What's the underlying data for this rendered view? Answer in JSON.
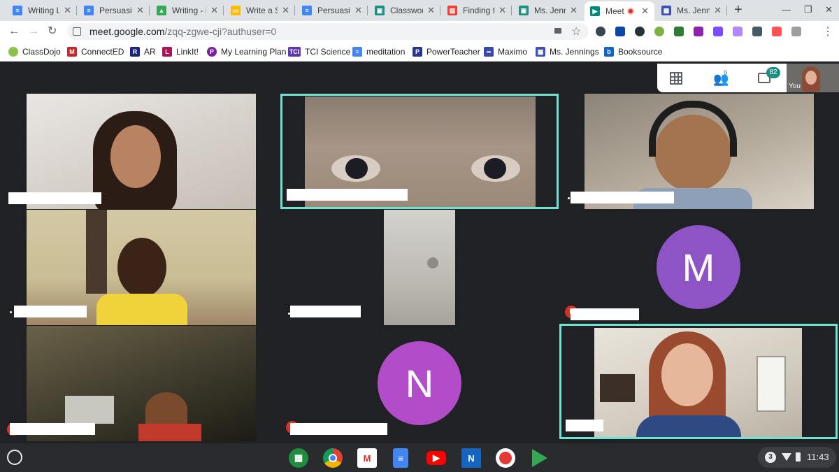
{
  "browser": {
    "tabs": [
      {
        "title": "Writing Le",
        "icon": "docs-icon",
        "color": "#4285f4",
        "active": false
      },
      {
        "title": "Persuasio",
        "icon": "docs-icon",
        "color": "#4285f4",
        "active": false
      },
      {
        "title": "Writing - F",
        "icon": "drive-icon",
        "color": "#34a853",
        "active": false
      },
      {
        "title": "Write a St",
        "icon": "slides-icon",
        "color": "#fbbc04",
        "active": false
      },
      {
        "title": "Persuasio",
        "icon": "docs-icon",
        "color": "#4285f4",
        "active": false
      },
      {
        "title": "Classwor",
        "icon": "classroom-icon",
        "color": "#1e8e7e",
        "active": false
      },
      {
        "title": "Finding fi",
        "icon": "calendar-icon",
        "color": "#ea4335",
        "active": false
      },
      {
        "title": "Ms. Jenni",
        "icon": "classroom-icon",
        "color": "#1e8e7e",
        "active": false
      },
      {
        "title": "Meet",
        "icon": "meet-icon",
        "color": "#00897b",
        "active": true
      },
      {
        "title": "Ms. Jenni",
        "icon": "forms-icon",
        "color": "#3f51b5",
        "active": false
      }
    ],
    "url_host": "meet.google.com",
    "url_path": "/zqq-zgwe-cji?authuser=0",
    "bookmarks": [
      {
        "label": "ClassDojo",
        "icon": "classdojo-icon",
        "color": "#8bc34a"
      },
      {
        "label": "ConnectED",
        "icon": "connected-icon",
        "color": "#c62828"
      },
      {
        "label": "AR",
        "icon": "ar-icon",
        "color": "#1a237e"
      },
      {
        "label": "LinkIt!",
        "icon": "linkit-icon",
        "color": "#ad1457"
      },
      {
        "label": "My Learning Plan",
        "icon": "mlp-icon",
        "color": "#7b1fa2"
      },
      {
        "label": "TCI Science",
        "icon": "tci-icon",
        "color": "#5e35b1"
      },
      {
        "label": "meditation",
        "icon": "docs-icon",
        "color": "#4285f4"
      },
      {
        "label": "PowerTeacher",
        "icon": "powerteacher-icon",
        "color": "#283593"
      },
      {
        "label": "Maximo",
        "icon": "maximo-icon",
        "color": "#3949ab"
      },
      {
        "label": "Ms. Jennings",
        "icon": "forms-icon",
        "color": "#3f51b5"
      },
      {
        "label": "Booksource",
        "icon": "booksource-icon",
        "color": "#1565c0"
      }
    ]
  },
  "meet": {
    "people_count": "9",
    "chat_count": "82",
    "self_label": "You",
    "avatars": [
      {
        "letter": "M",
        "color": "#8e53c4"
      },
      {
        "letter": "N",
        "color": "#b24cc9"
      }
    ]
  },
  "shelf": {
    "apps": [
      {
        "name": "classroom-app-icon",
        "color": "#1e8e3e",
        "glyph": "▦"
      },
      {
        "name": "chrome-app-icon",
        "color": "#db4437",
        "glyph": ""
      },
      {
        "name": "gmail-app-icon",
        "color": "#ffffff",
        "glyph": "M"
      },
      {
        "name": "docs-app-icon",
        "color": "#4285f4",
        "glyph": "≡"
      },
      {
        "name": "youtube-app-icon",
        "color": "#ff0000",
        "glyph": "▶"
      },
      {
        "name": "news-app-icon",
        "color": "#1565c0",
        "glyph": "N"
      },
      {
        "name": "record-app-icon",
        "color": "#e53935",
        "glyph": ""
      },
      {
        "name": "play-store-app-icon",
        "color": "#ffffff",
        "glyph": "▶"
      }
    ],
    "notification_count": "3",
    "time": "11:43"
  }
}
